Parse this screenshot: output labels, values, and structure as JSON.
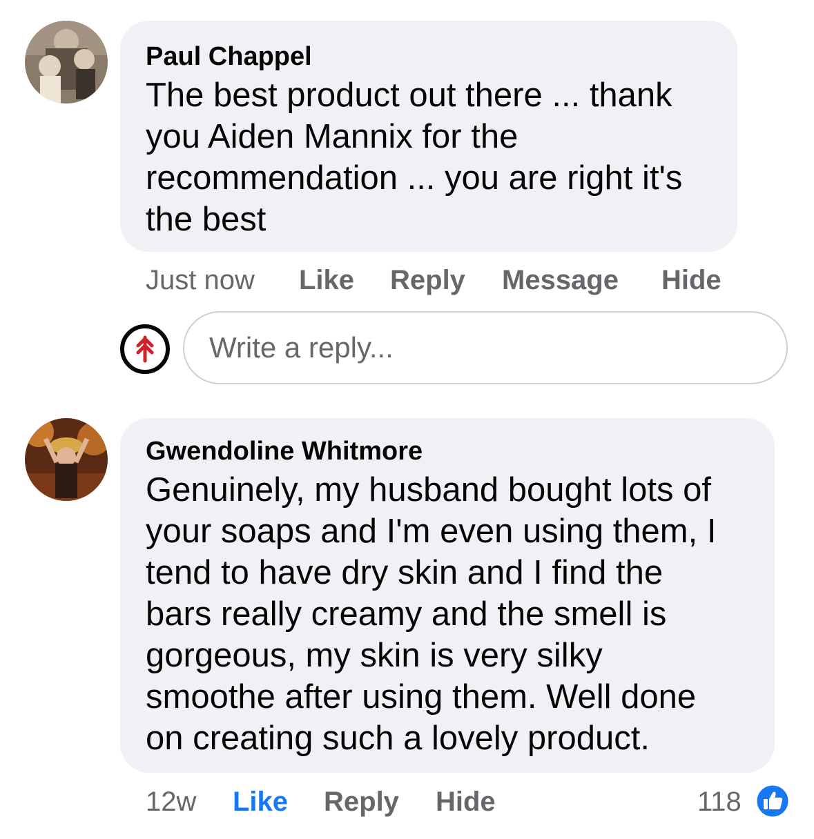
{
  "comments": [
    {
      "author": "Paul Chappel",
      "text_lines": [
        "The best product out there ... thank",
        "you Aiden Mannix for the",
        "recommendation ... you are right it's",
        "the best"
      ],
      "actions": {
        "time": "Just now",
        "like": "Like",
        "reply": "Reply",
        "message": "Message",
        "hide": "Hide"
      }
    },
    {
      "author": "Gwendoline Whitmore",
      "text_lines": [
        "Genuinely,  my husband bought lots of",
        "your soaps and I'm even using them, I",
        "tend to have dry skin and I find the",
        "bars really creamy and the smell is",
        "gorgeous,  my skin is very silky",
        "smoothe after using them. Well done",
        "on creating such a lovely product."
      ],
      "actions": {
        "time": "12w",
        "like": "Like",
        "reply": "Reply",
        "hide": "Hide"
      },
      "reaction_count": "118",
      "liked": true
    }
  ],
  "reply_box": {
    "placeholder": "Write a reply..."
  },
  "icons": {
    "page_avatar": "arrow-up-logo-icon",
    "like_reaction": "thumbs-up-icon"
  },
  "colors": {
    "bubble": "#f0f1f5",
    "meta_text": "#65676b",
    "liked_blue": "#1877f2",
    "logo_red": "#d0202a"
  }
}
